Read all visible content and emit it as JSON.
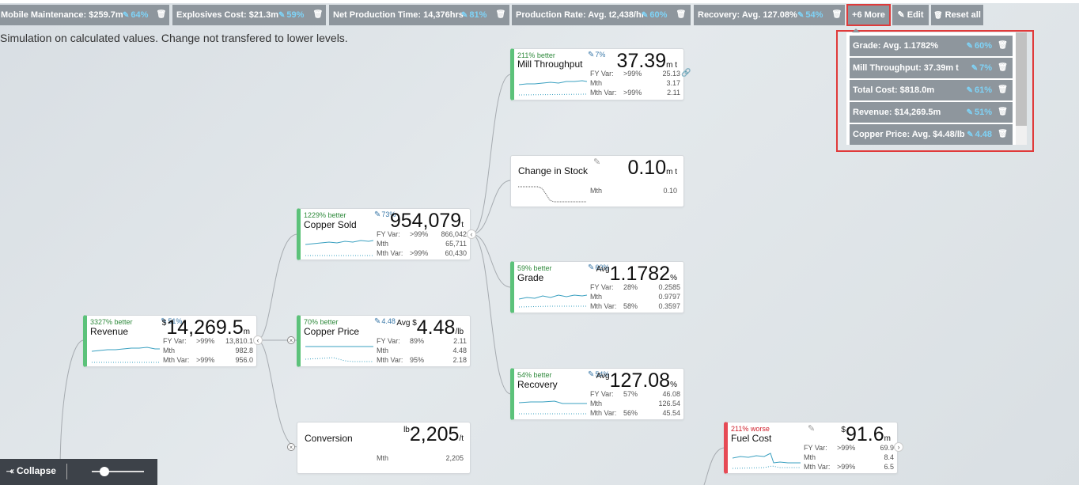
{
  "chips": [
    {
      "label": "Mobile Maintenance: $259.7m",
      "pct": "64%"
    },
    {
      "label": "Explosives Cost: $21.3m",
      "pct": "59%"
    },
    {
      "label": "Net Production Time: 14,376hrs",
      "pct": "81%"
    },
    {
      "label": "Production Rate: Avg. t2,438/hr",
      "pct": "60%"
    },
    {
      "label": "Recovery: Avg. 127.08%",
      "pct": "54%"
    }
  ],
  "toolbar": {
    "more_label": "+6 More",
    "edit_label": "Edit",
    "reset_label": "Reset all"
  },
  "note": "Simulation on calculated values. Change not transfered to lower levels.",
  "popup": {
    "items": [
      {
        "label": "Grade: Avg. 1.1782%",
        "pct": "60%"
      },
      {
        "label": "Mill Throughput: 37.39m t",
        "pct": "7%"
      },
      {
        "label": "Total Cost: $818.0m",
        "pct": "61%"
      },
      {
        "label": "Revenue: $14,269.5m",
        "pct": "51%"
      },
      {
        "label": "Copper Price: Avg. $4.48/lb",
        "pct": "4.48"
      }
    ]
  },
  "cards": {
    "revenue": {
      "status": "3327% better",
      "title": "Revenue",
      "pct": "51%",
      "prefix": "$",
      "value": "14,269.5",
      "unit": "m",
      "fy_label": "FY Var:",
      "fy_mid": ">99%",
      "fy_num": "13,810.1",
      "mth_label": "Mth",
      "mth_num": "982.8",
      "mv_label": "Mth Var:",
      "mv_mid": ">99%",
      "mv_num": "956.0"
    },
    "copper_sold": {
      "status": "1229% better",
      "title": "Copper Sold",
      "pct": "73%",
      "prefix": "",
      "value": "954,079",
      "unit": "t",
      "fy_label": "FY Var:",
      "fy_mid": ">99%",
      "fy_num": "866,042",
      "mth_label": "Mth",
      "mth_num": "65,711",
      "mv_label": "Mth Var:",
      "mv_mid": ">99%",
      "mv_num": "60,430"
    },
    "copper_price": {
      "status": "70% better",
      "title": "Copper Price",
      "pct": "4.48",
      "prefix": "Avg $",
      "value": "4.48",
      "unit": "/lb",
      "fy_label": "FY Var:",
      "fy_mid": "89%",
      "fy_num": "2.11",
      "mth_label": "Mth",
      "mth_num": "4.48",
      "mv_label": "Mth Var:",
      "mv_mid": "95%",
      "mv_num": "2.18"
    },
    "conversion": {
      "title": "Conversion",
      "prefix": "lb",
      "value": "2,205",
      "unit": "/t",
      "mth_label": "Mth",
      "mth_num": "2,205"
    },
    "mill_throughput": {
      "status": "211% better",
      "title": "Mill Throughput",
      "pct": "7%",
      "prefix": "",
      "value": "37.39",
      "unit": "m t",
      "fy_label": "FY Var:",
      "fy_mid": ">99%",
      "fy_num": "25.13",
      "mth_label": "Mth",
      "mth_num": "3.17",
      "mv_label": "Mth Var:",
      "mv_mid": ">99%",
      "mv_num": "2.11"
    },
    "change_in_stock": {
      "title": "Change in Stock",
      "prefix": "",
      "value": "0.10",
      "unit": "m t",
      "mth_label": "Mth",
      "mth_num": "0.10"
    },
    "grade": {
      "status": "59% better",
      "title": "Grade",
      "pct": "60%",
      "prefix": "Avg",
      "value": "1.1782",
      "unit": "%",
      "fy_label": "FY Var:",
      "fy_mid": "28%",
      "fy_num": "0.2585",
      "mth_label": "Mth",
      "mth_num": "0.9797",
      "mv_label": "Mth Var:",
      "mv_mid": "58%",
      "mv_num": "0.3597"
    },
    "recovery": {
      "status": "54% better",
      "title": "Recovery",
      "pct": "54%",
      "prefix": "Avg",
      "value": "127.08",
      "unit": "%",
      "fy_label": "FY Var:",
      "fy_mid": "57%",
      "fy_num": "46.08",
      "mth_label": "Mth",
      "mth_num": "126.54",
      "mv_label": "Mth Var:",
      "mv_mid": "56%",
      "mv_num": "45.54"
    },
    "fuel_cost": {
      "status": "211% worse",
      "title": "Fuel Cost",
      "prefix": "$",
      "value": "91.6",
      "unit": "m",
      "fy_label": "FY Var:",
      "fy_mid": ">99%",
      "fy_num": "69.9",
      "mth_label": "Mth",
      "mth_num": "8.4",
      "mv_label": "Mth Var:",
      "mv_mid": ">99%",
      "mv_num": "6.5"
    }
  },
  "bottom": {
    "collapse_label": "Collapse"
  },
  "colors": {
    "better": "#2f8a3c",
    "worse": "#d0202c",
    "accent_green": "#5cc27a",
    "accent_red": "#e64a55",
    "chip_bg": "#8e969d",
    "pct_blue": "#7fd3f7"
  }
}
